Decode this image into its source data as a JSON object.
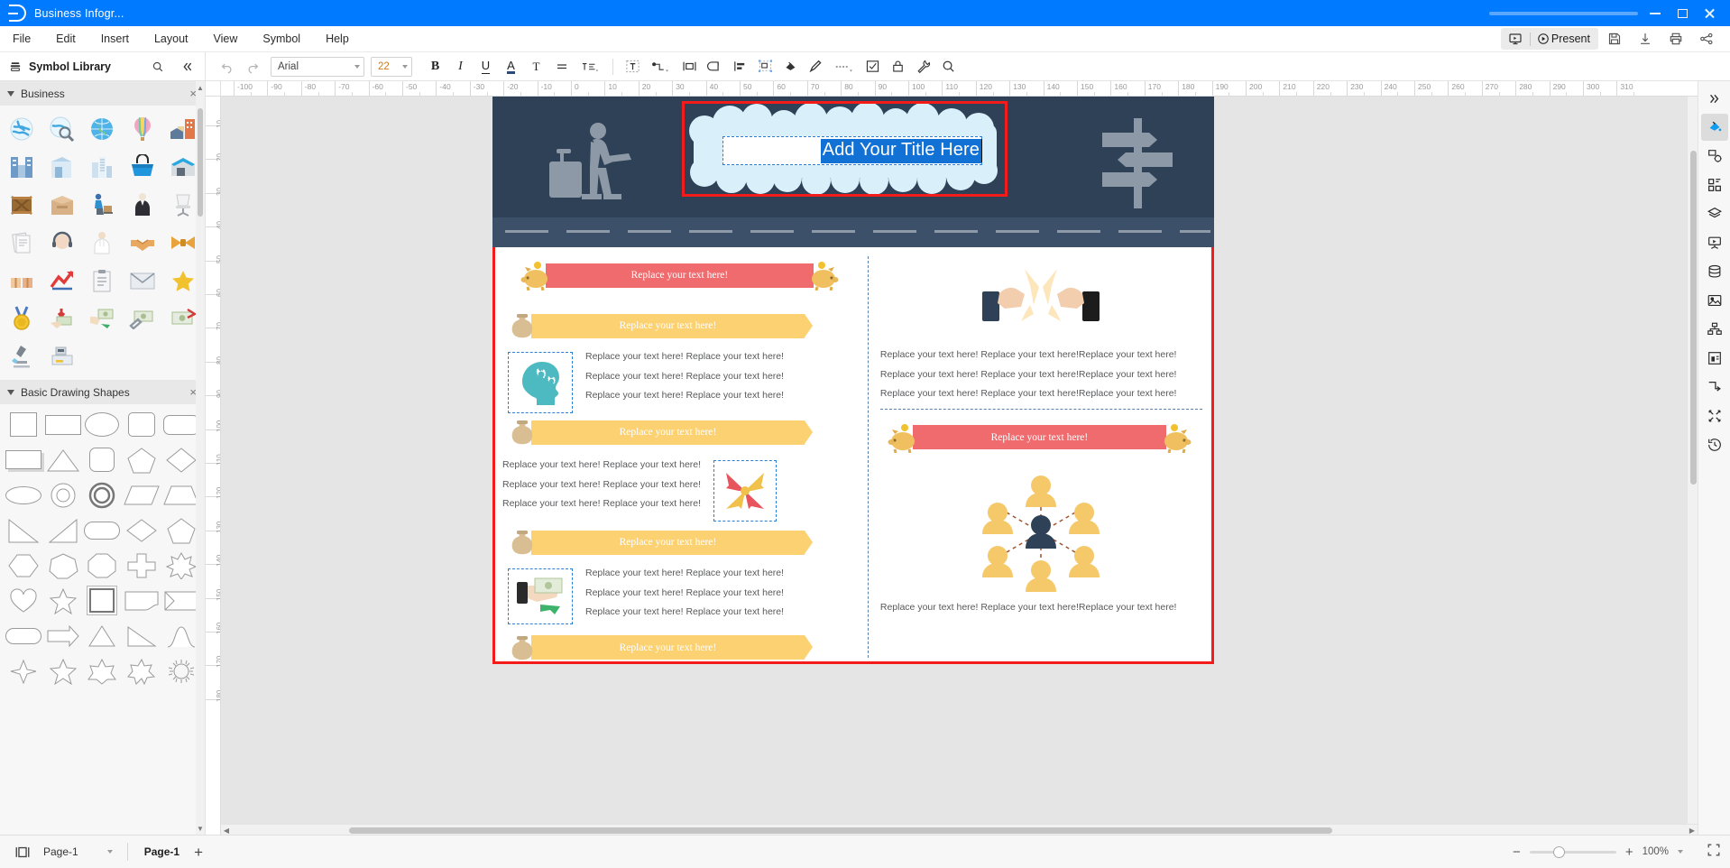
{
  "titlebar": {
    "document_title": "Business Infogr...",
    "logo": "edrawmax-logo"
  },
  "menubar": {
    "items": [
      "File",
      "Edit",
      "Insert",
      "Layout",
      "View",
      "Symbol",
      "Help"
    ],
    "present_label": "Present",
    "right_icons": [
      "slideshow-icon",
      "present-icon",
      "save-icon",
      "download-icon",
      "print-icon",
      "share-icon"
    ]
  },
  "library": {
    "title": "Symbol Library",
    "search_icon": "search-icon",
    "collapse_icon": "double-chevron-left-icon",
    "categories": [
      {
        "name": "Business",
        "close": "×",
        "symbols": [
          "globe-blue",
          "globe-search",
          "globe-grid",
          "hot-air-balloon",
          "buildings-orange",
          "skyscrapers",
          "office-block",
          "city-towers",
          "shopping-basket",
          "warehouse",
          "wooden-crate",
          "cardboard-box",
          "delivery-worker",
          "businessman-suit",
          "office-chair",
          "documents",
          "headset-support",
          "scientist",
          "handshake",
          "bowtie",
          "gift-boxes",
          "red-arrow-chart",
          "checklist-clipboard",
          "envelope-mail",
          "star-rating",
          "gold-medal",
          "hand-cash-down",
          "hand-money",
          "money-wrench",
          "money-percent",
          "microscope",
          "cash-register"
        ]
      },
      {
        "name": "Basic Drawing Shapes",
        "close": "×",
        "shapes": [
          "rectangle",
          "rectangle-wide",
          "ellipse",
          "rounded-square",
          "rounded-rectangle",
          "rectangle-shadow",
          "triangle",
          "square-rounded",
          "pentagon",
          "diamond",
          "ellipse-thin",
          "circle-ring",
          "circle-double",
          "parallelogram",
          "trapezoid",
          "triangle-left",
          "right-triangle",
          "stadium",
          "rhombus",
          "pentagon-2",
          "hexagon",
          "heptagon",
          "octagon",
          "cross-plus",
          "starburst",
          "heart",
          "star-5",
          "square-selected",
          "plaque",
          "flag-banner",
          "rounded-bar",
          "arrow-block",
          "triangle-outline",
          "arrow-triangle",
          "curve-shape",
          "star-4",
          "star-5-outline",
          "star-6",
          "star-7",
          "gear-sun"
        ]
      }
    ]
  },
  "toolbar": {
    "undo_icon": "undo-icon",
    "redo_icon": "redo-icon",
    "font_family": "Arial",
    "font_size": "22",
    "bold_label": "B",
    "italic_label": "I",
    "underline_label": "U",
    "font_color_label": "A",
    "text_style_label": "T",
    "align_icon": "align-icon",
    "text_spacing_icon": "text-spacing-icon",
    "text_box_icon": "text-box-icon",
    "connector_icon": "connector-icon",
    "group_icon": "group-icon",
    "duplicate_icon": "duplicate-icon",
    "align_objects_icon": "align-objects-icon",
    "select_icon": "select-all-icon",
    "fill_icon": "fill-bucket-icon",
    "line_icon": "pen-line-icon",
    "line_style_icon": "line-style-icon",
    "edit_icon": "edit-shape-icon",
    "lock_icon": "lock-icon",
    "tools_icon": "tools-icon",
    "search_icon": "search-icon"
  },
  "rulers": {
    "horizontal_ticks": [
      "-100",
      "-90",
      "-80",
      "-70",
      "-60",
      "-50",
      "-40",
      "-30",
      "-20",
      "-10",
      "0",
      "10",
      "20",
      "30",
      "40",
      "50",
      "60",
      "70",
      "80",
      "90",
      "100",
      "110",
      "120",
      "130",
      "140",
      "150",
      "160",
      "170",
      "180",
      "190",
      "200",
      "210",
      "220",
      "230",
      "240",
      "250",
      "260",
      "270",
      "280",
      "290",
      "300",
      "310"
    ],
    "vertical_ticks": [
      "10",
      "20",
      "30",
      "40",
      "50",
      "60",
      "70",
      "80",
      "90",
      "100",
      "110",
      "120",
      "130",
      "140",
      "150",
      "160",
      "170",
      "180"
    ]
  },
  "canvas": {
    "hero": {
      "title_text": "Add Your Title Here",
      "title_selected": true,
      "walker_icon": "businessman-with-luggage",
      "signpost_icon": "signpost-directions",
      "background_color": "#2f4156",
      "road_color": "#3c506a",
      "cloud_color": "#d9f0fb",
      "selection_color": "#f41b1b",
      "text_highlight_color": "#1271d4"
    },
    "left_column": {
      "banners": [
        {
          "style": "red",
          "text": "Replace your text here!",
          "left_icon": "piggy-bank",
          "right_icon": "piggy-bank"
        },
        {
          "style": "yellow",
          "text": "Replace your text here!",
          "left_icon": "money-sack"
        },
        {
          "style": "yellow",
          "text": "Replace your text here!",
          "left_icon": "money-sack"
        },
        {
          "style": "yellow",
          "text": "Replace your text here!",
          "left_icon": "money-sack"
        },
        {
          "style": "yellow",
          "text": "Replace your text here!",
          "left_icon": "money-sack"
        }
      ],
      "blocks": [
        {
          "icon": "head-with-gears",
          "icon_side": "left",
          "lines": [
            "Replace your text here! Replace your text here!",
            "Replace your text here! Replace your text here!",
            "Replace your text here! Replace your text here!"
          ]
        },
        {
          "icon": "teamwork-puzzle-arrows",
          "icon_side": "right",
          "lines": [
            "Replace your text here! Replace your text here!",
            "Replace your text here! Replace your text here!",
            "Replace your text here! Replace your text here!"
          ]
        },
        {
          "icon": "hand-giving-money",
          "icon_side": "left",
          "lines": [
            "Replace your text here! Replace your text here!",
            "Replace your text here! Replace your text here!",
            "Replace your text here! Replace your text here!"
          ]
        }
      ]
    },
    "right_column": {
      "top_icon": "cheers-toast-glasses",
      "top_lines": [
        "Replace your text here! Replace your text here!Replace your text here!",
        "Replace your text here! Replace your text here!Replace your text here!",
        "Replace your text here! Replace your text here!Replace your text here!"
      ],
      "banner": {
        "style": "red",
        "text": "Replace your text here!",
        "left_icon": "piggy-bank",
        "right_icon": "piggy-bank"
      },
      "network_icon": "people-network-diagram",
      "bottom_lines": [
        "Replace your text here! Replace your text here!Replace your text here!"
      ]
    }
  },
  "right_sidebar": {
    "collapse_icon": "double-chevron-right-icon",
    "items": [
      {
        "icon": "fill-bucket-icon",
        "active": true
      },
      {
        "icon": "shape-settings-icon",
        "active": false
      },
      {
        "icon": "grid-apps-icon",
        "active": false
      },
      {
        "icon": "layers-icon",
        "active": false
      },
      {
        "icon": "presentation-icon",
        "active": false
      },
      {
        "icon": "database-icon",
        "active": false
      },
      {
        "icon": "image-icon",
        "active": false
      },
      {
        "icon": "org-chart-icon",
        "active": false
      },
      {
        "icon": "container-icon",
        "active": false
      },
      {
        "icon": "connector-route-icon",
        "active": false
      },
      {
        "icon": "scatter-nodes-icon",
        "active": false
      },
      {
        "icon": "history-icon",
        "active": false
      }
    ]
  },
  "statusbar": {
    "page_view_icon": "page-view-icon",
    "page_select_value": "Page-1",
    "dropdown_icon": "chevron-down-icon",
    "active_page_tab": "Page-1",
    "add_page_label": "+",
    "zoom_out_label": "−",
    "zoom_in_label": "+",
    "zoom_level": "100%",
    "zoom_dropdown_icon": "chevron-down-icon",
    "fullscreen_icon": "fullscreen-icon"
  }
}
